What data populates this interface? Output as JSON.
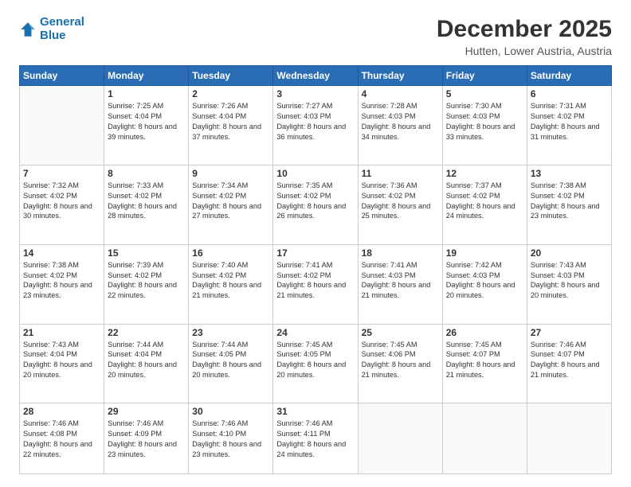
{
  "logo": {
    "line1": "General",
    "line2": "Blue"
  },
  "header": {
    "month": "December 2025",
    "location": "Hutten, Lower Austria, Austria"
  },
  "days_of_week": [
    "Sunday",
    "Monday",
    "Tuesday",
    "Wednesday",
    "Thursday",
    "Friday",
    "Saturday"
  ],
  "weeks": [
    [
      {
        "day": "",
        "empty": true
      },
      {
        "day": "1",
        "sunrise": "7:25 AM",
        "sunset": "4:04 PM",
        "daylight": "8 hours and 39 minutes."
      },
      {
        "day": "2",
        "sunrise": "7:26 AM",
        "sunset": "4:04 PM",
        "daylight": "8 hours and 37 minutes."
      },
      {
        "day": "3",
        "sunrise": "7:27 AM",
        "sunset": "4:03 PM",
        "daylight": "8 hours and 36 minutes."
      },
      {
        "day": "4",
        "sunrise": "7:28 AM",
        "sunset": "4:03 PM",
        "daylight": "8 hours and 34 minutes."
      },
      {
        "day": "5",
        "sunrise": "7:30 AM",
        "sunset": "4:03 PM",
        "daylight": "8 hours and 33 minutes."
      },
      {
        "day": "6",
        "sunrise": "7:31 AM",
        "sunset": "4:02 PM",
        "daylight": "8 hours and 31 minutes."
      }
    ],
    [
      {
        "day": "7",
        "sunrise": "7:32 AM",
        "sunset": "4:02 PM",
        "daylight": "8 hours and 30 minutes."
      },
      {
        "day": "8",
        "sunrise": "7:33 AM",
        "sunset": "4:02 PM",
        "daylight": "8 hours and 28 minutes."
      },
      {
        "day": "9",
        "sunrise": "7:34 AM",
        "sunset": "4:02 PM",
        "daylight": "8 hours and 27 minutes."
      },
      {
        "day": "10",
        "sunrise": "7:35 AM",
        "sunset": "4:02 PM",
        "daylight": "8 hours and 26 minutes."
      },
      {
        "day": "11",
        "sunrise": "7:36 AM",
        "sunset": "4:02 PM",
        "daylight": "8 hours and 25 minutes."
      },
      {
        "day": "12",
        "sunrise": "7:37 AM",
        "sunset": "4:02 PM",
        "daylight": "8 hours and 24 minutes."
      },
      {
        "day": "13",
        "sunrise": "7:38 AM",
        "sunset": "4:02 PM",
        "daylight": "8 hours and 23 minutes."
      }
    ],
    [
      {
        "day": "14",
        "sunrise": "7:38 AM",
        "sunset": "4:02 PM",
        "daylight": "8 hours and 23 minutes."
      },
      {
        "day": "15",
        "sunrise": "7:39 AM",
        "sunset": "4:02 PM",
        "daylight": "8 hours and 22 minutes."
      },
      {
        "day": "16",
        "sunrise": "7:40 AM",
        "sunset": "4:02 PM",
        "daylight": "8 hours and 21 minutes."
      },
      {
        "day": "17",
        "sunrise": "7:41 AM",
        "sunset": "4:02 PM",
        "daylight": "8 hours and 21 minutes."
      },
      {
        "day": "18",
        "sunrise": "7:41 AM",
        "sunset": "4:03 PM",
        "daylight": "8 hours and 21 minutes."
      },
      {
        "day": "19",
        "sunrise": "7:42 AM",
        "sunset": "4:03 PM",
        "daylight": "8 hours and 20 minutes."
      },
      {
        "day": "20",
        "sunrise": "7:43 AM",
        "sunset": "4:03 PM",
        "daylight": "8 hours and 20 minutes."
      }
    ],
    [
      {
        "day": "21",
        "sunrise": "7:43 AM",
        "sunset": "4:04 PM",
        "daylight": "8 hours and 20 minutes."
      },
      {
        "day": "22",
        "sunrise": "7:44 AM",
        "sunset": "4:04 PM",
        "daylight": "8 hours and 20 minutes."
      },
      {
        "day": "23",
        "sunrise": "7:44 AM",
        "sunset": "4:05 PM",
        "daylight": "8 hours and 20 minutes."
      },
      {
        "day": "24",
        "sunrise": "7:45 AM",
        "sunset": "4:05 PM",
        "daylight": "8 hours and 20 minutes."
      },
      {
        "day": "25",
        "sunrise": "7:45 AM",
        "sunset": "4:06 PM",
        "daylight": "8 hours and 21 minutes."
      },
      {
        "day": "26",
        "sunrise": "7:45 AM",
        "sunset": "4:07 PM",
        "daylight": "8 hours and 21 minutes."
      },
      {
        "day": "27",
        "sunrise": "7:46 AM",
        "sunset": "4:07 PM",
        "daylight": "8 hours and 21 minutes."
      }
    ],
    [
      {
        "day": "28",
        "sunrise": "7:46 AM",
        "sunset": "4:08 PM",
        "daylight": "8 hours and 22 minutes."
      },
      {
        "day": "29",
        "sunrise": "7:46 AM",
        "sunset": "4:09 PM",
        "daylight": "8 hours and 23 minutes."
      },
      {
        "day": "30",
        "sunrise": "7:46 AM",
        "sunset": "4:10 PM",
        "daylight": "8 hours and 23 minutes."
      },
      {
        "day": "31",
        "sunrise": "7:46 AM",
        "sunset": "4:11 PM",
        "daylight": "8 hours and 24 minutes."
      },
      {
        "day": "",
        "empty": true
      },
      {
        "day": "",
        "empty": true
      },
      {
        "day": "",
        "empty": true
      }
    ]
  ]
}
